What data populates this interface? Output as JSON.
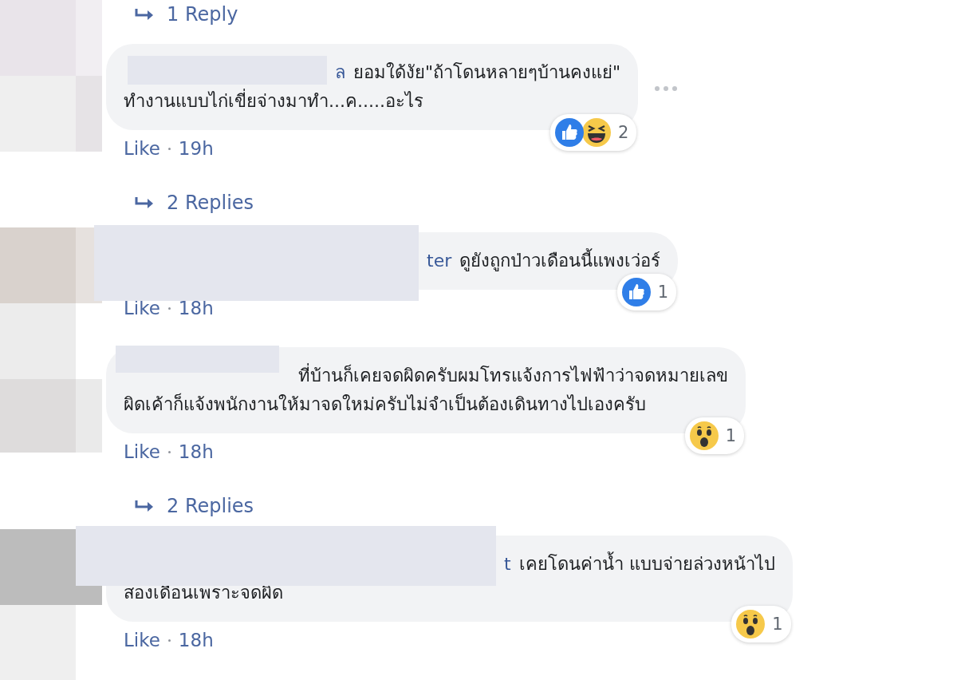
{
  "items": [
    {
      "kind": "replies_link",
      "text": "1 Reply"
    },
    {
      "kind": "comment",
      "name_fragment": "ล",
      "lines": [
        "ยอมใด้งัย\"ถ้าโดนหลายๆบ้านคงแย่\"",
        "ทำงานแบบไก่เขี่ยจ่างมาทำ...ค.....อะไร"
      ],
      "reactions": [
        {
          "kind": "like"
        },
        {
          "kind": "haha"
        }
      ],
      "reaction_count": "2",
      "like": "Like",
      "time": "19h",
      "more_menu": true
    },
    {
      "kind": "replies_link",
      "text": "2 Replies"
    },
    {
      "kind": "comment",
      "name_fragment": "ter",
      "lines": [
        "ดูยังถูกป่าวเดือนนี้แพงเว่อร์"
      ],
      "reactions": [
        {
          "kind": "like"
        }
      ],
      "reaction_count": "1",
      "like": "Like",
      "time": "18h",
      "more_menu": false
    },
    {
      "kind": "comment",
      "lines": [
        "ที่บ้านก็เคยจดผิดครับผมโทรแจ้งการไฟฟ้าว่าจดหมายเลข",
        "ผิดเค้าก็แจ้งพนักงานให้มาจดใหม่ครับไม่จำเป็นต้องเดินทางไปเองครับ"
      ],
      "reactions": [
        {
          "kind": "wow"
        }
      ],
      "reaction_count": "1",
      "like": "Like",
      "time": "18h",
      "more_menu": false
    },
    {
      "kind": "replies_link",
      "text": "2 Replies"
    },
    {
      "kind": "comment",
      "name_fragment": "t",
      "lines": [
        "เคยโดนค่าน้ำ แบบจ่ายล่วงหน้าไป",
        "สองเดือนเพราะจดผิด"
      ],
      "reactions": [
        {
          "kind": "wow"
        }
      ],
      "reaction_count": "1",
      "like": "Like",
      "time": "18h",
      "more_menu": false
    }
  ]
}
